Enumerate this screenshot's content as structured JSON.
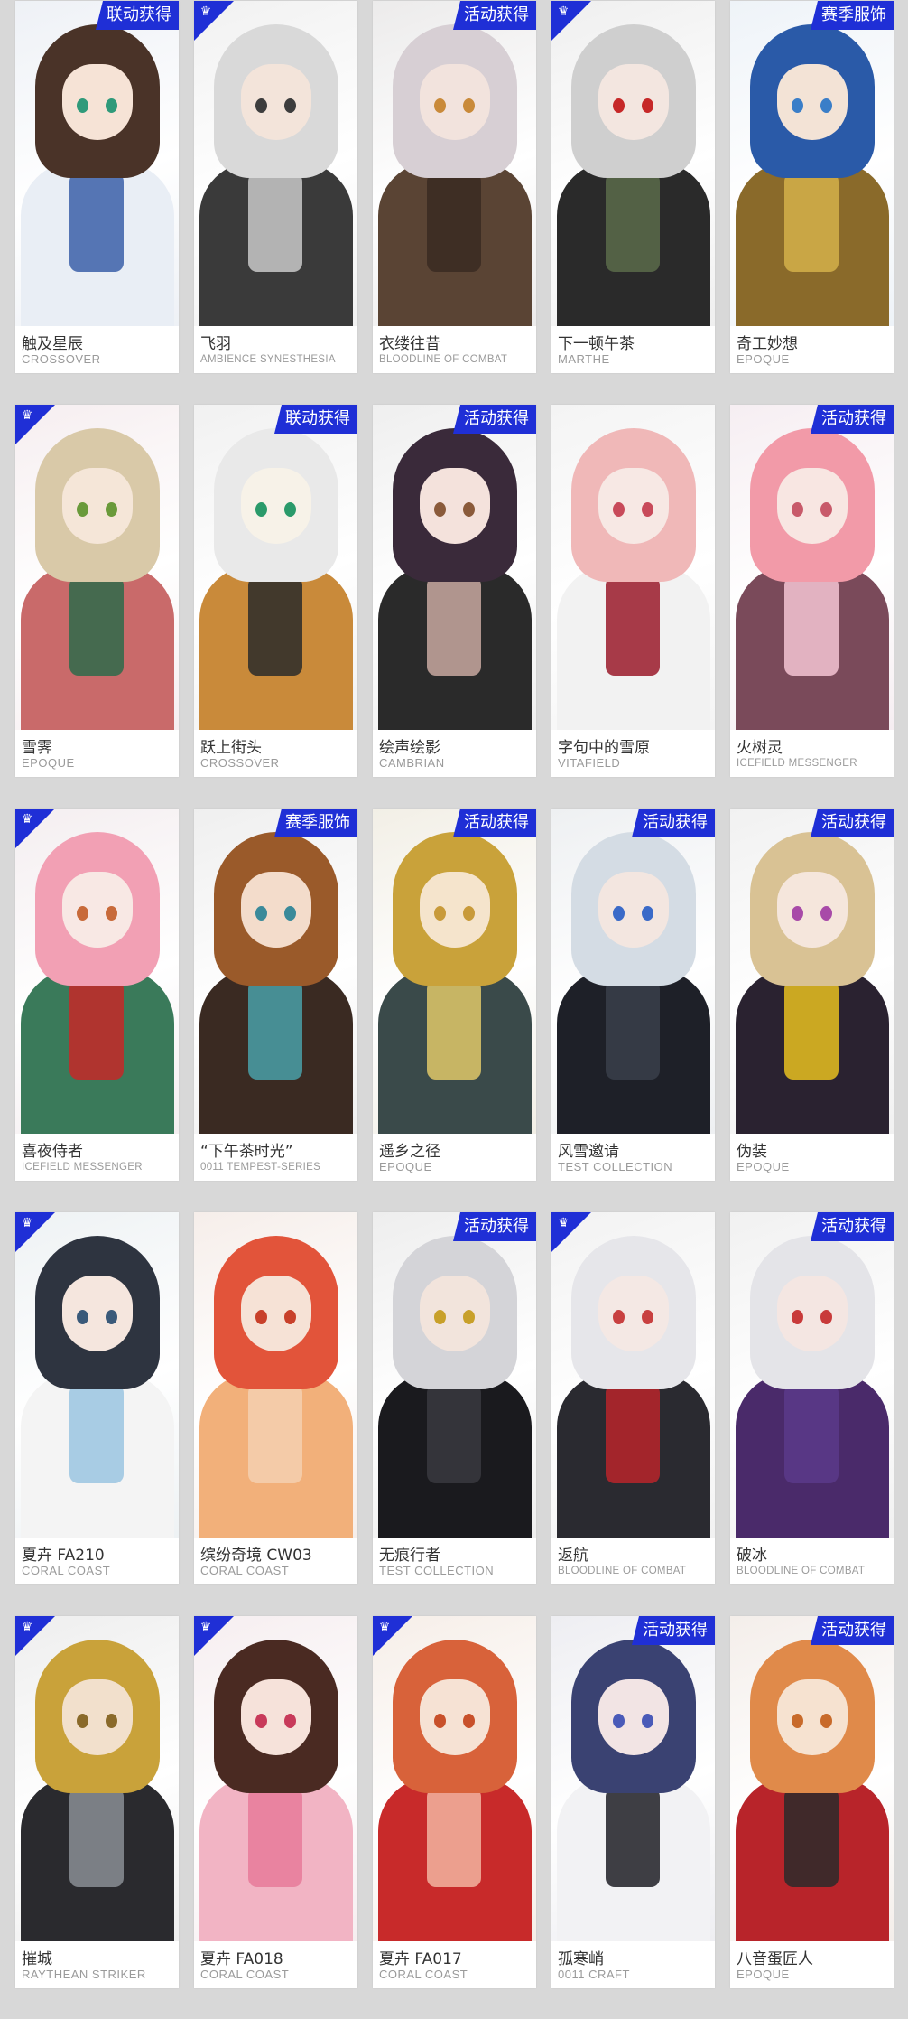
{
  "palette": {
    "badge_blue": "#1f2fd6",
    "page_bg": "#d8d8d8",
    "card_bg": "#ffffff",
    "name_text": "#333333",
    "series_text": "#9a9a9a"
  },
  "badges": {
    "crossover": "联动获得",
    "event": "活动获得",
    "season": "赛季服饰"
  },
  "cards": [
    {
      "name": "触及星辰",
      "series": "CROSSOVER",
      "source": "联动获得",
      "corner": false,
      "hair": "#4a3328",
      "skin": "#f6e3d6",
      "eye": "#2f9a7a",
      "outfit": "#e9eef5",
      "accent": "#3b5fa8",
      "bg": "#eef1f6"
    },
    {
      "name": "飞羽",
      "series": "AMBIENCE SYNESTHESIA",
      "source": "",
      "corner": true,
      "hair": "#d9d9d9",
      "skin": "#f3e4da",
      "eye": "#3d3d3d",
      "outfit": "#3a3a3a",
      "accent": "#c9c9c9",
      "bg": "#f1f1f1"
    },
    {
      "name": "衣缕往昔",
      "series": "BLOODLINE OF COMBAT",
      "source": "活动获得",
      "corner": false,
      "hair": "#d7cfd4",
      "skin": "#f2e3dd",
      "eye": "#c98a3a",
      "outfit": "#5a4434",
      "accent": "#3a2a22",
      "bg": "#ecebeb"
    },
    {
      "name": "下一顿午茶",
      "series": "MARTHE",
      "source": "",
      "corner": true,
      "hair": "#cfcfcf",
      "skin": "#f3e6e0",
      "eye": "#c62828",
      "outfit": "#2a2a2a",
      "accent": "#5b6b4a",
      "bg": "#efefef"
    },
    {
      "name": "奇工妙想",
      "series": "EPOQUE",
      "source": "赛季服饰",
      "corner": false,
      "hair": "#2a5aa8",
      "skin": "#f3e3d6",
      "eye": "#3a7ec8",
      "outfit": "#8a6a2a",
      "accent": "#d4b04a",
      "bg": "#eef3f8"
    },
    {
      "name": "雪霁",
      "series": "EPOQUE",
      "source": "",
      "corner": true,
      "hair": "#d9c9a8",
      "skin": "#f5e6d8",
      "eye": "#6a9a3a",
      "outfit": "#c96a6a",
      "accent": "#2e6a4a",
      "bg": "#f6eef0"
    },
    {
      "name": "跃上街头",
      "series": "CROSSOVER",
      "source": "联动获得",
      "corner": false,
      "hair": "#e9e9e9",
      "skin": "#f7f2e8",
      "eye": "#2a9a6a",
      "outfit": "#c98a3a",
      "accent": "#2a2a2a",
      "bg": "#f1f1f1"
    },
    {
      "name": "绘声绘影",
      "series": "CAMBRIAN",
      "source": "活动获得",
      "corner": false,
      "hair": "#3a2a3a",
      "skin": "#f4e2dc",
      "eye": "#8a5a3a",
      "outfit": "#2a2a2a",
      "accent": "#c8a8a0",
      "bg": "#efefef"
    },
    {
      "name": "字句中的雪原",
      "series": "VITAFIELD",
      "source": "",
      "corner": false,
      "hair": "#f0b8b8",
      "skin": "#f7e8e4",
      "eye": "#c84a5a",
      "outfit": "#f2f2f2",
      "accent": "#9a1a2a",
      "bg": "#f4f4f4"
    },
    {
      "name": "火树灵",
      "series": "ICEFIELD MESSENGER",
      "source": "活动获得",
      "corner": false,
      "hair": "#f29aa8",
      "skin": "#f8e6e2",
      "eye": "#c85a6a",
      "outfit": "#7a4a5a",
      "accent": "#f4c4d4",
      "bg": "#f6eef2"
    },
    {
      "name": "喜夜侍者",
      "series": "ICEFIELD MESSENGER",
      "source": "",
      "corner": true,
      "hair": "#f2a0b4",
      "skin": "#f8e8e4",
      "eye": "#c86a3a",
      "outfit": "#3a7a5a",
      "accent": "#c62828",
      "bg": "#f4eef0"
    },
    {
      "name": "“下午茶时光”",
      "series": "0011 TEMPEST-SERIES",
      "source": "赛季服饰",
      "corner": false,
      "hair": "#9a5a2a",
      "skin": "#f3dccb",
      "eye": "#3a8a9a",
      "outfit": "#3a2a22",
      "accent": "#4aa0a8",
      "bg": "#efefef"
    },
    {
      "name": "遥乡之径",
      "series": "EPOQUE",
      "source": "活动获得",
      "corner": false,
      "hair": "#c9a23a",
      "skin": "#f5e4cc",
      "eye": "#c89a3a",
      "outfit": "#3a4a4a",
      "accent": "#e0c868",
      "bg": "#f2efe6"
    },
    {
      "name": "风雪邀请",
      "series": "TEST COLLECTION",
      "source": "活动获得",
      "corner": false,
      "hair": "#d4dce4",
      "skin": "#f3e6e0",
      "eye": "#3a6ac8",
      "outfit": "#1e2028",
      "accent": "#3a3f4a",
      "bg": "#eef0f2"
    },
    {
      "name": "伪装",
      "series": "EPOQUE",
      "source": "活动获得",
      "corner": false,
      "hair": "#d9c294",
      "skin": "#f5e6dc",
      "eye": "#a84aa8",
      "outfit": "#2a2230",
      "accent": "#e8c020",
      "bg": "#f1f1f1"
    },
    {
      "name": "夏卉 FA210",
      "series": "CORAL COAST",
      "source": "",
      "corner": true,
      "hair": "#2e3440",
      "skin": "#f5e6de",
      "eye": "#3a5a7a",
      "outfit": "#f4f4f4",
      "accent": "#9ac4e0",
      "bg": "#eef2f4"
    },
    {
      "name": "缤纷奇境 CW03",
      "series": "CORAL COAST",
      "source": "",
      "corner": false,
      "hair": "#e2543a",
      "skin": "#f6e2d6",
      "eye": "#c8402a",
      "outfit": "#f2b07a",
      "accent": "#f4d0b0",
      "bg": "#f6eeea"
    },
    {
      "name": "无痕行者",
      "series": "TEST COLLECTION",
      "source": "活动获得",
      "corner": false,
      "hair": "#d4d4d8",
      "skin": "#f2e4dc",
      "eye": "#c8a02a",
      "outfit": "#1a1a1e",
      "accent": "#3a3a40",
      "bg": "#eeeeee"
    },
    {
      "name": "返航",
      "series": "BLOODLINE OF COMBAT",
      "source": "",
      "corner": true,
      "hair": "#e6e6ea",
      "skin": "#f4e8e4",
      "eye": "#c84040",
      "outfit": "#2a2a30",
      "accent": "#b8242a",
      "bg": "#f2f2f2"
    },
    {
      "name": "破冰",
      "series": "BLOODLINE OF COMBAT",
      "source": "活动获得",
      "corner": false,
      "hair": "#e4e4e8",
      "skin": "#f4e6e2",
      "eye": "#c83a3a",
      "outfit": "#4a2a6a",
      "accent": "#5a3a8a",
      "bg": "#f1f1f1"
    },
    {
      "name": "摧城",
      "series": "RAYTHEAN STRIKER",
      "source": "",
      "corner": true,
      "hair": "#c9a23a",
      "skin": "#f2e0cc",
      "eye": "#8a6a2a",
      "outfit": "#2a2a2e",
      "accent": "#8a8e94",
      "bg": "#eeeeee"
    },
    {
      "name": "夏卉 FA018",
      "series": "CORAL COAST",
      "source": "",
      "corner": true,
      "hair": "#4a2a22",
      "skin": "#f6e2da",
      "eye": "#c83a5a",
      "outfit": "#f2b4c4",
      "accent": "#e87a9a",
      "bg": "#f6eef0"
    },
    {
      "name": "夏卉 FA017",
      "series": "CORAL COAST",
      "source": "",
      "corner": true,
      "hair": "#d8623a",
      "skin": "#f6e2d4",
      "eye": "#c8502a",
      "outfit": "#c82a2a",
      "accent": "#f2b4a0",
      "bg": "#f6eee8"
    },
    {
      "name": "孤寒峭",
      "series": "0011 CRAFT",
      "source": "活动获得",
      "corner": false,
      "hair": "#3a4272",
      "skin": "#f2e4e4",
      "eye": "#4a5ab8",
      "outfit": "#f2f2f4",
      "accent": "#1e1e24",
      "bg": "#eeeef2"
    },
    {
      "name": "八音蛋匠人",
      "series": "EPOQUE",
      "source": "活动获得",
      "corner": false,
      "hair": "#e08a4a",
      "skin": "#f6e2d0",
      "eye": "#c86a2a",
      "outfit": "#b8242a",
      "accent": "#2a2a2a",
      "bg": "#f4eeea"
    }
  ]
}
